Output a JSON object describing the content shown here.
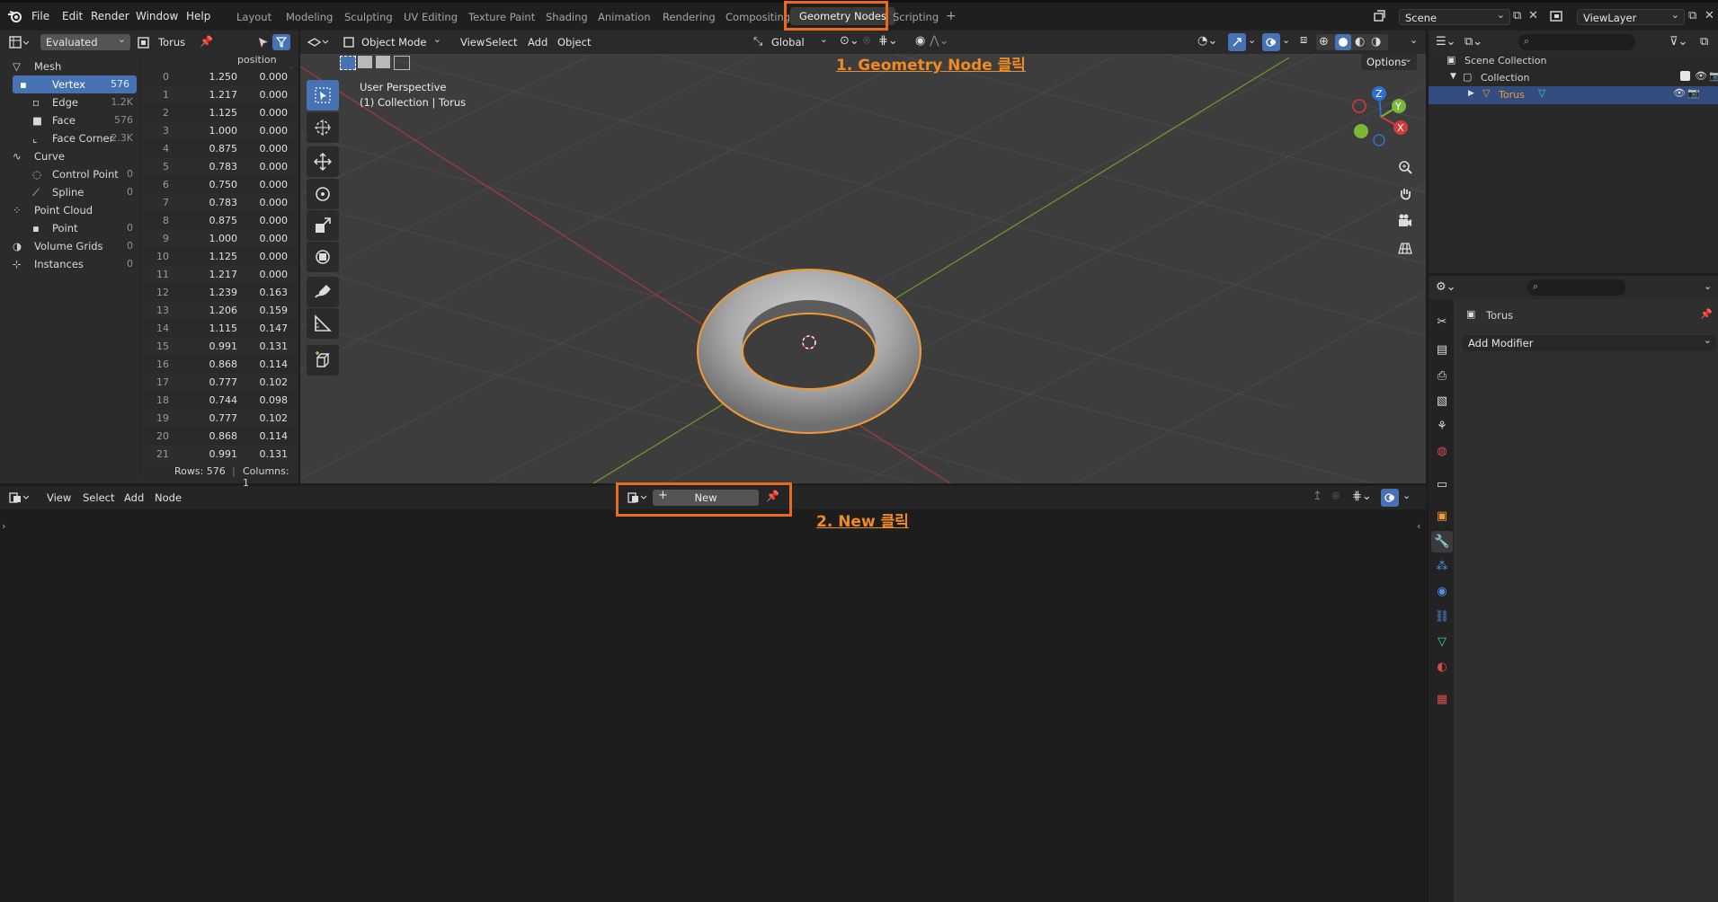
{
  "menu": [
    "File",
    "Edit",
    "Render",
    "Window",
    "Help"
  ],
  "workspaces": [
    "Layout",
    "Modeling",
    "Sculpting",
    "UV Editing",
    "Texture Paint",
    "Shading",
    "Animation",
    "Rendering",
    "Compositing",
    "Geometry Nodes",
    "Scripting"
  ],
  "scene": {
    "label": "Scene",
    "view_layer": "ViewLayer"
  },
  "spreadsheet": {
    "mode": "Evaluated",
    "object": "Torus",
    "column_header": "position",
    "tree": [
      {
        "label": "Mesh",
        "count": ""
      },
      {
        "label": "Vertex",
        "count": "576"
      },
      {
        "label": "Edge",
        "count": "1.2K"
      },
      {
        "label": "Face",
        "count": "576"
      },
      {
        "label": "Face Corner",
        "count": "2.3K"
      },
      {
        "label": "Curve",
        "count": ""
      },
      {
        "label": "Control Point",
        "count": "0"
      },
      {
        "label": "Spline",
        "count": "0"
      },
      {
        "label": "Point Cloud",
        "count": ""
      },
      {
        "label": "Point",
        "count": "0"
      },
      {
        "label": "Volume Grids",
        "count": "0"
      },
      {
        "label": "Instances",
        "count": "0"
      }
    ],
    "rows": [
      [
        "0",
        "1.250",
        "0.000"
      ],
      [
        "1",
        "1.217",
        "0.000"
      ],
      [
        "2",
        "1.125",
        "0.000"
      ],
      [
        "3",
        "1.000",
        "0.000"
      ],
      [
        "4",
        "0.875",
        "0.000"
      ],
      [
        "5",
        "0.783",
        "0.000"
      ],
      [
        "6",
        "0.750",
        "0.000"
      ],
      [
        "7",
        "0.783",
        "0.000"
      ],
      [
        "8",
        "0.875",
        "0.000"
      ],
      [
        "9",
        "1.000",
        "0.000"
      ],
      [
        "10",
        "1.125",
        "0.000"
      ],
      [
        "11",
        "1.217",
        "0.000"
      ],
      [
        "12",
        "1.239",
        "0.163"
      ],
      [
        "13",
        "1.206",
        "0.159"
      ],
      [
        "14",
        "1.115",
        "0.147"
      ],
      [
        "15",
        "0.991",
        "0.131"
      ],
      [
        "16",
        "0.868",
        "0.114"
      ],
      [
        "17",
        "0.777",
        "0.102"
      ],
      [
        "18",
        "0.744",
        "0.098"
      ],
      [
        "19",
        "0.777",
        "0.102"
      ],
      [
        "20",
        "0.868",
        "0.114"
      ],
      [
        "21",
        "0.991",
        "0.131"
      ]
    ],
    "footer_rows": "Rows: 576",
    "footer_cols": "Columns: 1"
  },
  "viewport": {
    "mode": "Object Mode",
    "menus": [
      "View",
      "Select",
      "Add",
      "Object"
    ],
    "orientation": "Global",
    "options": "Options",
    "info_line1": "User Perspective",
    "info_line2": "(1) Collection | Torus"
  },
  "outliner": {
    "scene_collection": "Scene Collection",
    "collection": "Collection",
    "object": "Torus"
  },
  "properties": {
    "object": "Torus",
    "add_modifier": "Add Modifier"
  },
  "node_editor": {
    "menus": [
      "View",
      "Select",
      "Add",
      "Node"
    ],
    "new_label": "New"
  },
  "annotations": {
    "step1": "1. Geometry Node 클릭",
    "step2": "2. New 클릭"
  },
  "colors": {
    "accent": "#4772b3",
    "highlight": "#ec6a1c",
    "annotation": "#f08a24",
    "object_outline": "#f39a35"
  }
}
